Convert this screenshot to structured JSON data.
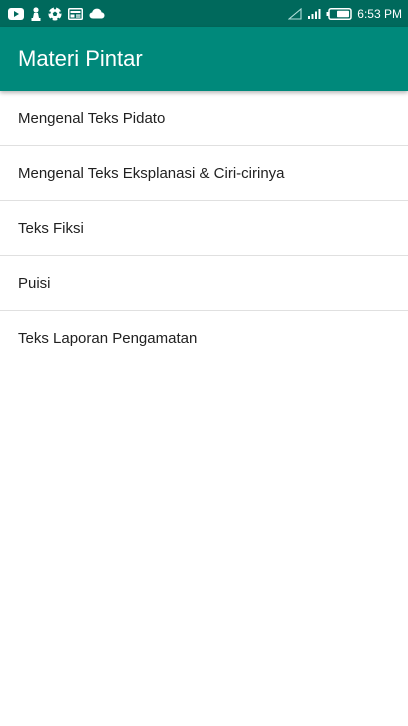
{
  "status_bar": {
    "time": "6:53 PM",
    "background": "#00695c",
    "left_icons": [
      "youtube-icon",
      "chess-piece-icon",
      "soccer-ball-icon",
      "news-icon",
      "cloud-icon"
    ],
    "right_icons": [
      "no-signal-icon",
      "signal-icon",
      "battery-icon"
    ]
  },
  "app_bar": {
    "title": "Materi Pintar",
    "background": "#00897b"
  },
  "list": {
    "items": [
      {
        "label": "Mengenal Teks Pidato"
      },
      {
        "label": "Mengenal Teks Eksplanasi & Ciri-cirinya"
      },
      {
        "label": "Teks Fiksi"
      },
      {
        "label": "Puisi"
      },
      {
        "label": "Teks Laporan Pengamatan"
      }
    ]
  }
}
